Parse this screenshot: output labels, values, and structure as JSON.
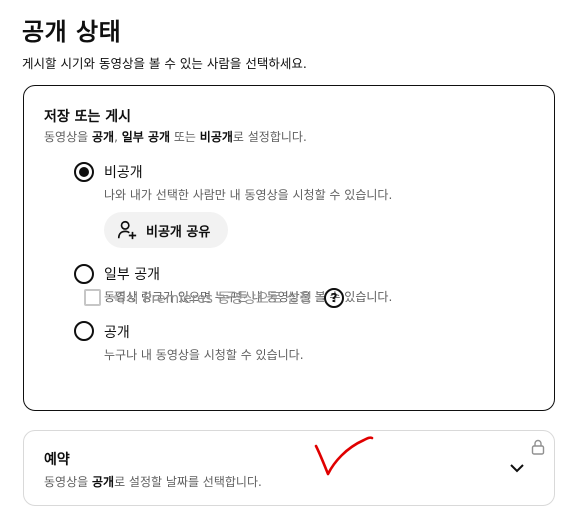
{
  "header": {
    "title": "공개 상태",
    "subtitle": "게시할 시기와 동영상을 볼 수 있는 사람을 선택하세요."
  },
  "save_publish": {
    "title": "저장 또는 게시",
    "desc_parts": [
      "동영상을 ",
      "공개",
      ", ",
      "일부 공개",
      " 또는 ",
      "비공개",
      "로 설정합니다."
    ],
    "options": [
      {
        "label": "비공개",
        "desc": "나와 내가 선택한 사람만 내 동영상을 시청할 수 있습니다.",
        "checked": true
      },
      {
        "label": "일부 공개",
        "desc": "동영상 링크가 있으면 누구든 내 동영상을 볼 수 있습니다.",
        "checked": false
      },
      {
        "label": "공개",
        "desc": "누구나 내 동영상을 시청할 수 있습니다.",
        "checked": false
      }
    ],
    "share_button": "비공개 공유",
    "premiere_checkbox": "즉시 Premieres 동영상으로 설정",
    "premiere_checked": false,
    "help_icon_glyph": "?"
  },
  "schedule": {
    "title": "예약",
    "desc_parts": [
      "동영상을 ",
      "공개",
      "로 설정할 날짜를 선택합니다."
    ]
  },
  "colors": {
    "text": "#0f0f0f",
    "secondary": "#606060",
    "annotation": "#e00000"
  },
  "icons": [
    "radio-checked",
    "radio-unchecked",
    "person-add-icon",
    "help-icon",
    "lock-icon",
    "chevron-down-icon",
    "handwritten-checkmark"
  ]
}
